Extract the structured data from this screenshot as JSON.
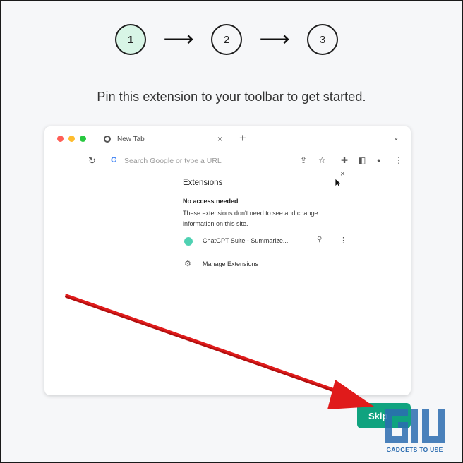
{
  "stepper": {
    "steps": [
      "1",
      "2",
      "3"
    ],
    "active_step": "1",
    "arrow_glyph": "⟶"
  },
  "headline": "Pin this extension to your toolbar to get started.",
  "browser": {
    "tab_title": "New Tab",
    "tab_close": "×",
    "new_tab": "+",
    "tab_menu": "⌄",
    "reload": "↻",
    "search_engine_glyph": "G",
    "address_placeholder": "Search Google or type a URL",
    "toolbar_icons": {
      "share": "⇪",
      "star": "☆",
      "puzzle": "✚",
      "sidepanel": "◧",
      "profile": "●",
      "menu": "⋮"
    }
  },
  "extensions_popup": {
    "close": "×",
    "title": "Extensions",
    "subheading": "No access needed",
    "description": "These extensions don't need to see and change information on this site.",
    "item": {
      "name": "ChatGPT Suite - Summarize...",
      "pin": "⚲",
      "more": "⋮"
    },
    "manage_icon": "⚙",
    "manage_label": "Manage Extensions"
  },
  "skip_button": "Skip",
  "watermark": {
    "text": "GADGETS TO USE"
  },
  "colors": {
    "accent_green": "#10a37f",
    "active_step_bg": "#d8f5e6",
    "annotation_red": "#e01b1b",
    "watermark_blue": "#2b6cb0"
  }
}
